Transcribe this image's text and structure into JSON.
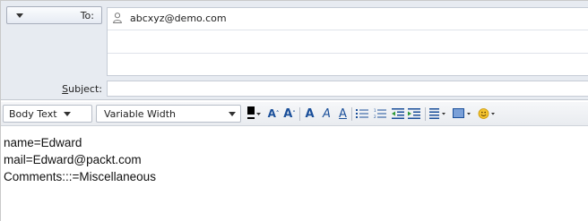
{
  "header": {
    "to_button_label": "To:",
    "recipients": [
      "abcxyz@demo.com"
    ],
    "subject_label_accel": "S",
    "subject_label_rest": "ubject:",
    "subject_value": ""
  },
  "toolbar": {
    "paragraph_style": "Body Text",
    "font_name": "Variable Width",
    "bold": "A",
    "italic": "A",
    "underline": "A",
    "grow": "A",
    "shrink": "A"
  },
  "body": {
    "lines": [
      "name=Edward",
      "mail=Edward@packt.com",
      "Comments:::=Miscellaneous"
    ]
  },
  "colors": {
    "header_bg": "#e7ebf1",
    "icon_blue": "#1a4f9a",
    "emoji_yellow": "#f4c430"
  }
}
